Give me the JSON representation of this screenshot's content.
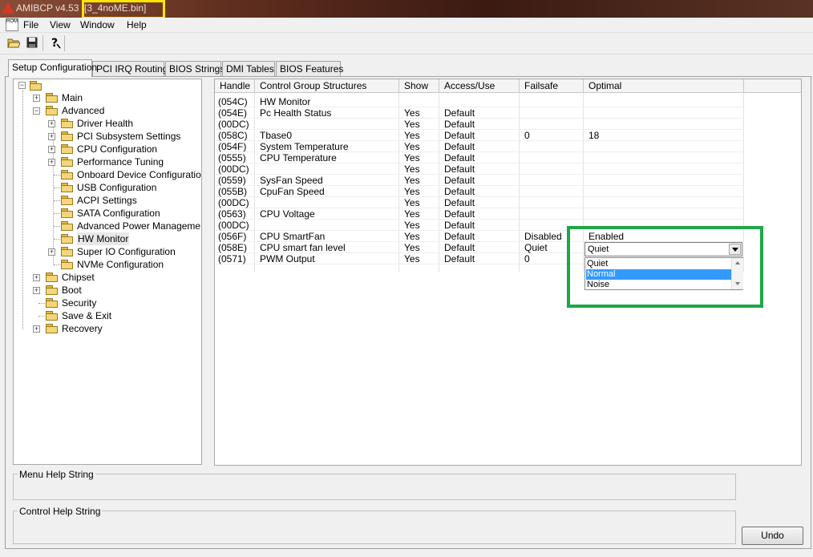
{
  "title_bar": {
    "app_title": "AMIBCP v4.53 -",
    "file_name": "[3_4noME.bin]"
  },
  "menu": [
    "File",
    "View",
    "Window",
    "Help"
  ],
  "mdi_icon_text": "ROM",
  "toolbar": {
    "icons": [
      "open-folder-icon",
      "save-disk-icon",
      "help-icon"
    ]
  },
  "tabs": [
    "Setup Configuration",
    "PCI IRQ Routing",
    "BIOS Strings",
    "DMI Tables",
    "BIOS Features"
  ],
  "tree": {
    "root_label": "",
    "items": [
      {
        "label": "Main",
        "expander": "+"
      },
      {
        "label": "Advanced",
        "expander": "-"
      },
      {
        "label": "Driver Health",
        "expander": "+"
      },
      {
        "label": "PCI Subsystem Settings",
        "expander": "+"
      },
      {
        "label": "CPU Configuration",
        "expander": "+"
      },
      {
        "label": "Performance Tuning",
        "expander": "+"
      },
      {
        "label": "Onboard Device Configuration",
        "expander": ""
      },
      {
        "label": "USB Configuration",
        "expander": ""
      },
      {
        "label": "ACPI Settings",
        "expander": ""
      },
      {
        "label": "SATA Configuration",
        "expander": ""
      },
      {
        "label": "Advanced Power Management",
        "expander": ""
      },
      {
        "label": "HW Monitor",
        "expander": ""
      },
      {
        "label": "Super IO Configuration",
        "expander": "+"
      },
      {
        "label": "NVMe Configuration",
        "expander": ""
      },
      {
        "label": "Chipset",
        "expander": "+"
      },
      {
        "label": "Boot",
        "expander": "+"
      },
      {
        "label": "Security",
        "expander": ""
      },
      {
        "label": "Save & Exit",
        "expander": ""
      },
      {
        "label": "Recovery",
        "expander": "+"
      }
    ]
  },
  "grid": {
    "columns": [
      "Handle",
      "Control Group Structures",
      "Show",
      "Access/Use",
      "Failsafe",
      "Optimal"
    ],
    "rows": [
      [
        "(054C)",
        "HW Monitor",
        "",
        "",
        "",
        ""
      ],
      [
        "(054E)",
        "Pc Health Status",
        "Yes",
        "Default",
        "",
        ""
      ],
      [
        "(00DC)",
        "",
        "Yes",
        "Default",
        "",
        ""
      ],
      [
        "(058C)",
        "Tbase0",
        "Yes",
        "Default",
        "0",
        "18"
      ],
      [
        "(054F)",
        "System Temperature",
        "Yes",
        "Default",
        "",
        ""
      ],
      [
        "(0555)",
        "CPU Temperature",
        "Yes",
        "Default",
        "",
        ""
      ],
      [
        "(00DC)",
        "",
        "Yes",
        "Default",
        "",
        ""
      ],
      [
        "(0559)",
        "SysFan Speed",
        "Yes",
        "Default",
        "",
        ""
      ],
      [
        "(055B)",
        "CpuFan Speed",
        "Yes",
        "Default",
        "",
        ""
      ],
      [
        "(00DC)",
        "",
        "Yes",
        "Default",
        "",
        ""
      ],
      [
        "(0563)",
        "CPU Voltage",
        "Yes",
        "Default",
        "",
        ""
      ],
      [
        "(00DC)",
        "",
        "Yes",
        "Default",
        "",
        ""
      ],
      [
        "(056F)",
        "CPU SmartFan",
        "Yes",
        "Default",
        "Disabled",
        "Enabled"
      ],
      [
        "(058E)",
        "CPU smart fan level",
        "Yes",
        "Default",
        "Quiet",
        ""
      ],
      [
        "(0571)",
        " PWM Output",
        "Yes",
        "Default",
        "0",
        ""
      ]
    ]
  },
  "dropdown": {
    "selected": "Quiet",
    "options": [
      "Quiet",
      "Normal",
      "Noise"
    ],
    "highlighted_index": 1
  },
  "help": {
    "menu_help_label": "Menu Help String",
    "control_help_label": "Control Help String"
  },
  "buttons": {
    "undo": "Undo"
  },
  "colors": {
    "highlight_box": "#1fa648",
    "title_highlight": "#ffe600",
    "selection": "#3399ff"
  }
}
